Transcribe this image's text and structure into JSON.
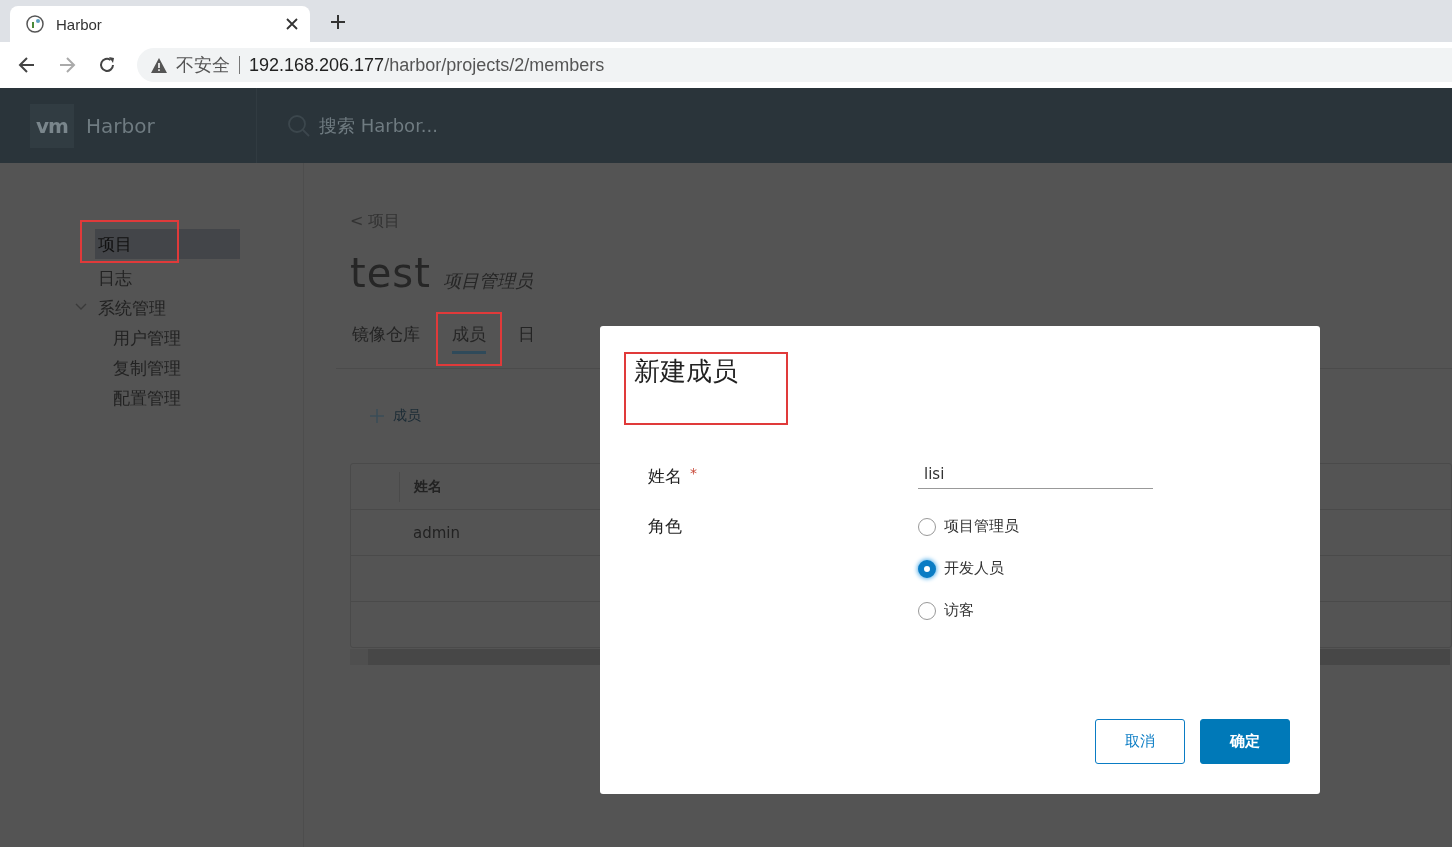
{
  "browser": {
    "tab_title": "Harbor",
    "security_label": "不安全",
    "url_host": "192.168.206.177",
    "url_path": "/harbor/projects/2/members"
  },
  "header": {
    "logo": "vm",
    "product": "Harbor",
    "search_placeholder": "搜索 Harbor..."
  },
  "sidebar": {
    "items": [
      {
        "label": "项目",
        "selected": true,
        "marked": true
      },
      {
        "label": "日志",
        "selected": false,
        "marked": false
      },
      {
        "label": "系统管理",
        "selected": false,
        "marked": false,
        "expanded": true,
        "children": [
          {
            "label": "用户管理",
            "selected": false,
            "marked": false
          },
          {
            "label": "复制管理",
            "selected": false,
            "marked": false
          },
          {
            "label": "配置管理",
            "selected": false,
            "marked": false
          }
        ]
      }
    ]
  },
  "breadcrumb": "< 项目",
  "project": {
    "name": "test",
    "role": "项目管理员"
  },
  "tabs": [
    {
      "label": "镜像仓库",
      "selected": false,
      "marked": false
    },
    {
      "label": "成员",
      "selected": true,
      "marked": true
    },
    {
      "label": "日",
      "selected": false,
      "marked": false
    }
  ],
  "add_member": {
    "label": "成员"
  },
  "table": {
    "columns": [
      "姓名"
    ],
    "rows": [
      [
        "admin"
      ]
    ]
  },
  "dialog": {
    "title": "新建成员",
    "title_marked": true,
    "name_field": {
      "label": "姓名",
      "required": true,
      "required_mark": "*",
      "value": "lisi"
    },
    "role_field": {
      "label": "角色",
      "options": [
        {
          "label": "项目管理员",
          "selected": false
        },
        {
          "label": "开发人员",
          "selected": true
        },
        {
          "label": "访客",
          "selected": false
        }
      ]
    },
    "buttons": [
      {
        "label": "取消",
        "kind": "secondary"
      },
      {
        "label": "确定",
        "kind": "primary"
      }
    ]
  }
}
